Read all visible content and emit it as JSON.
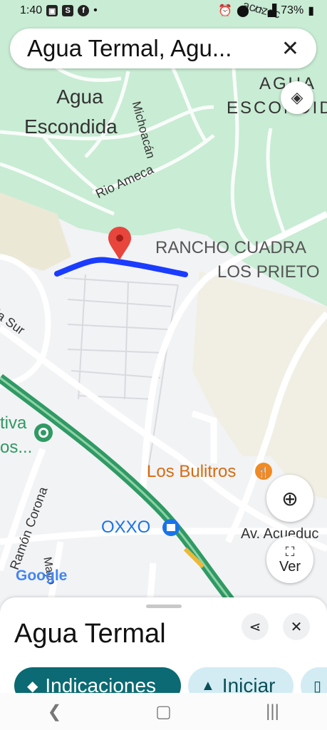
{
  "status_bar": {
    "time": "1:40",
    "battery": "73%"
  },
  "search": {
    "query": "Agua Termal, Agu..."
  },
  "map_labels": {
    "agua_escondida_1": "Agua",
    "agua_escondida_2": "Escondida",
    "agua_escondida_right_1": "AGUA",
    "agua_escondida_right_2": "ESCONDID",
    "michoacan": "Michoacán",
    "rio_ameca": "Rio Ameca",
    "rancho_1": "RANCHO CUADRA",
    "rancho_2": "LOS PRIETO",
    "street_sur": "la Sur",
    "tiva": "tiva",
    "os": "os...",
    "los_bulitros": "Los Bulitros",
    "oxxo": "OXXO",
    "av_acueducto": "Av. Acueduc",
    "ramon_corona": "Ramón Corona",
    "mayo": "Mayo",
    "top_street": "acuzac",
    "google": "Google"
  },
  "buttons": {
    "ver_label": "Ver"
  },
  "sheet": {
    "title": "Agua Termal",
    "directions_label": "Indicaciones",
    "start_label": "Iniciar"
  },
  "colors": {
    "route_blue": "#1a3cff",
    "park_green": "#c9ecd4",
    "highway_green": "#2f9a63",
    "pin_red": "#e8453c",
    "chip_teal": "#0b6a73",
    "chip_light": "#d3ecf4"
  }
}
